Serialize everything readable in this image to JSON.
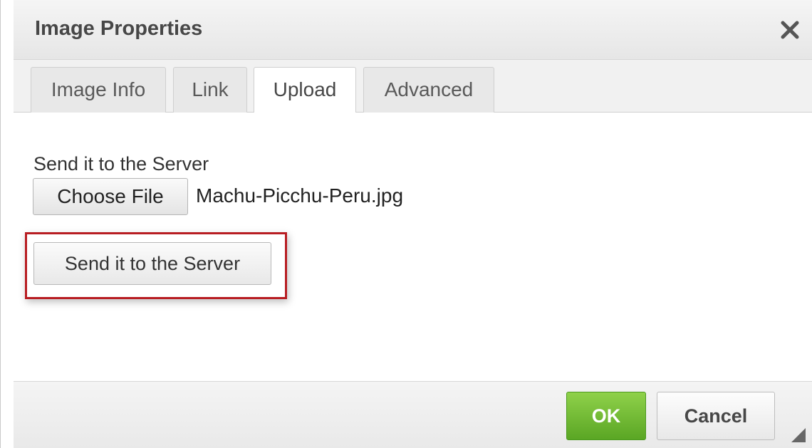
{
  "dialog": {
    "title": "Image Properties",
    "close_icon": "close-icon"
  },
  "tabs": [
    {
      "label": "Image Info",
      "active": false
    },
    {
      "label": "Link",
      "active": false
    },
    {
      "label": "Upload",
      "active": true
    },
    {
      "label": "Advanced",
      "active": false
    }
  ],
  "upload": {
    "label": "Send it to the Server",
    "choose_file_label": "Choose File",
    "file_name": "Machu-Picchu-Peru.jpg",
    "send_button_label": "Send it to the Server"
  },
  "footer": {
    "ok_label": "OK",
    "cancel_label": "Cancel"
  },
  "colors": {
    "ok_green": "#6ab62f",
    "highlight_red": "#b81d22"
  }
}
